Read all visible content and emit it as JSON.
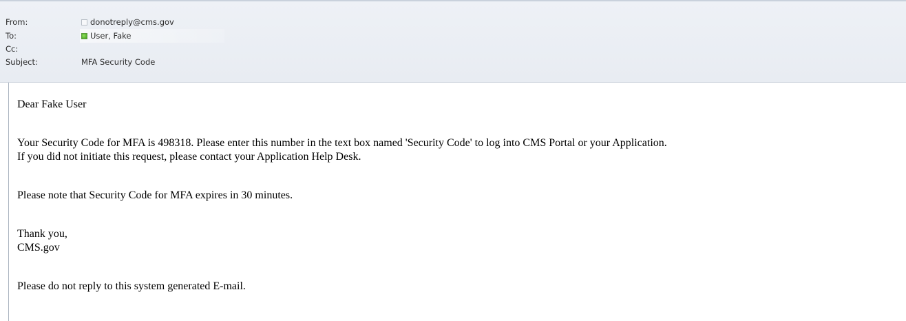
{
  "header": {
    "from_label": "From:",
    "from_value": "donotreply@cms.gov",
    "to_label": "To:",
    "to_value": "User, Fake",
    "cc_label": "Cc:",
    "cc_value": "",
    "subject_label": "Subject:",
    "subject_value": "MFA Security Code",
    "presence_colors": {
      "unknown": "#b8bec6",
      "available": "#3c9a1c"
    },
    "icons": {
      "from": "presence-unknown-icon",
      "to": "presence-available-icon"
    }
  },
  "body": {
    "greeting": "Dear Fake User",
    "line1": "Your Security Code for MFA is 498318. Please enter this number in the text box named 'Security Code' to log into CMS Portal or your Application.",
    "line2": "If you did not initiate this request, please contact your Application Help Desk.",
    "expiry": "Please note that Security Code for MFA expires in 30 minutes.",
    "thanks": "Thank you,",
    "signature": "CMS.gov",
    "footer": "Please do not reply to this system generated E-mail."
  }
}
